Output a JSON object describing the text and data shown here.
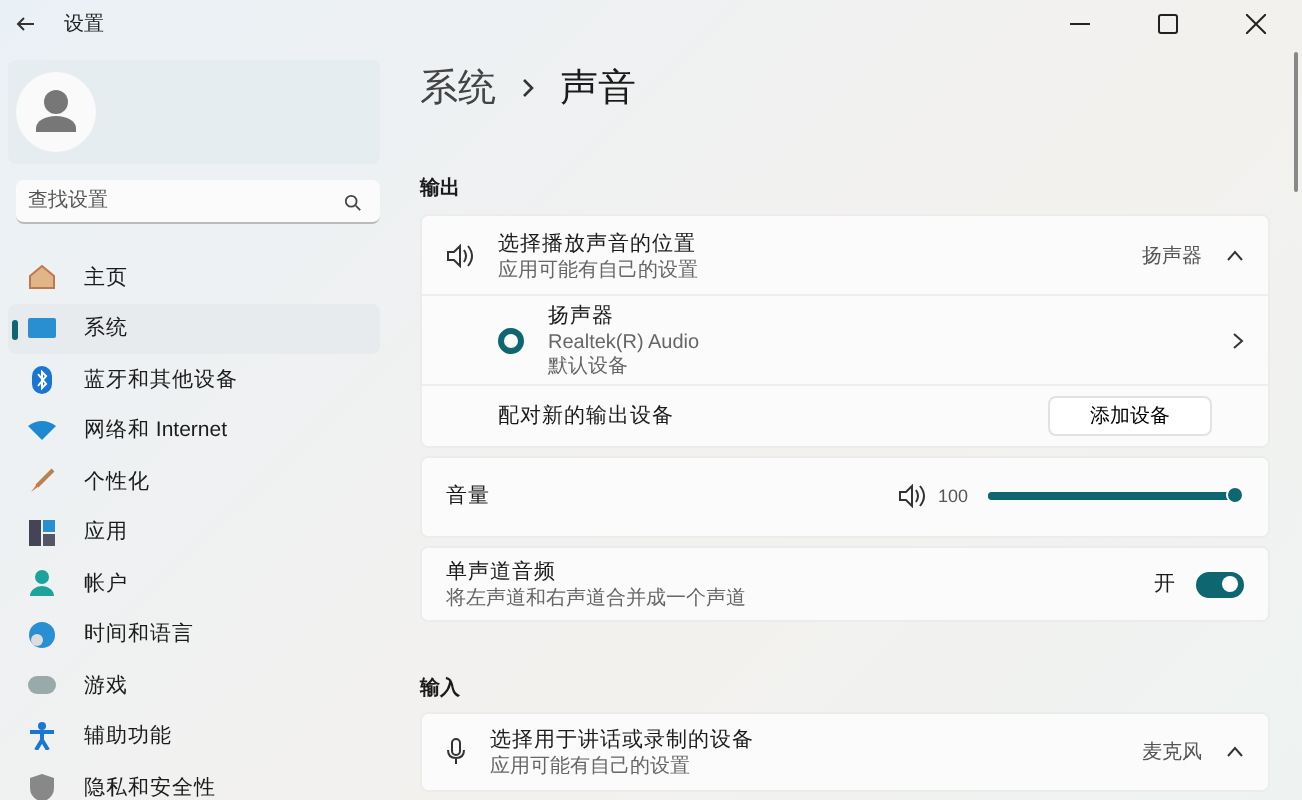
{
  "window": {
    "title": "设置"
  },
  "sidebar": {
    "search": {
      "placeholder": "查找设置"
    },
    "items": [
      {
        "label": "主页",
        "selected": false
      },
      {
        "label": "系统",
        "selected": true
      },
      {
        "label": "蓝牙和其他设备",
        "selected": false
      },
      {
        "label": "网络和 Internet",
        "selected": false
      },
      {
        "label": "个性化",
        "selected": false
      },
      {
        "label": "应用",
        "selected": false
      },
      {
        "label": "帐户",
        "selected": false
      },
      {
        "label": "时间和语言",
        "selected": false
      },
      {
        "label": "游戏",
        "selected": false
      },
      {
        "label": "辅助功能",
        "selected": false
      },
      {
        "label": "隐私和安全性",
        "selected": false
      }
    ]
  },
  "breadcrumb": [
    "系统",
    "声音"
  ],
  "output": {
    "heading": "输出",
    "picker": {
      "title": "选择播放声音的位置",
      "subtitle": "应用可能有自己的设置",
      "value": "扬声器",
      "expanded": true
    },
    "devices": [
      {
        "name": "扬声器",
        "driver": "Realtek(R) Audio",
        "status": "默认设备",
        "selected": true
      }
    ],
    "pair": {
      "label": "配对新的输出设备",
      "button": "添加设备"
    },
    "volume": {
      "label": "音量",
      "reading": "100",
      "level": 1.0
    },
    "mono": {
      "title": "单声道音频",
      "subtitle": "将左声道和右声道合并成一个声道",
      "state_label": "开",
      "on": true
    }
  },
  "input": {
    "heading": "输入",
    "picker": {
      "title": "选择用于讲话或录制的设备",
      "subtitle": "应用可能有自己的设置",
      "value": "麦克风",
      "expanded": true
    }
  }
}
